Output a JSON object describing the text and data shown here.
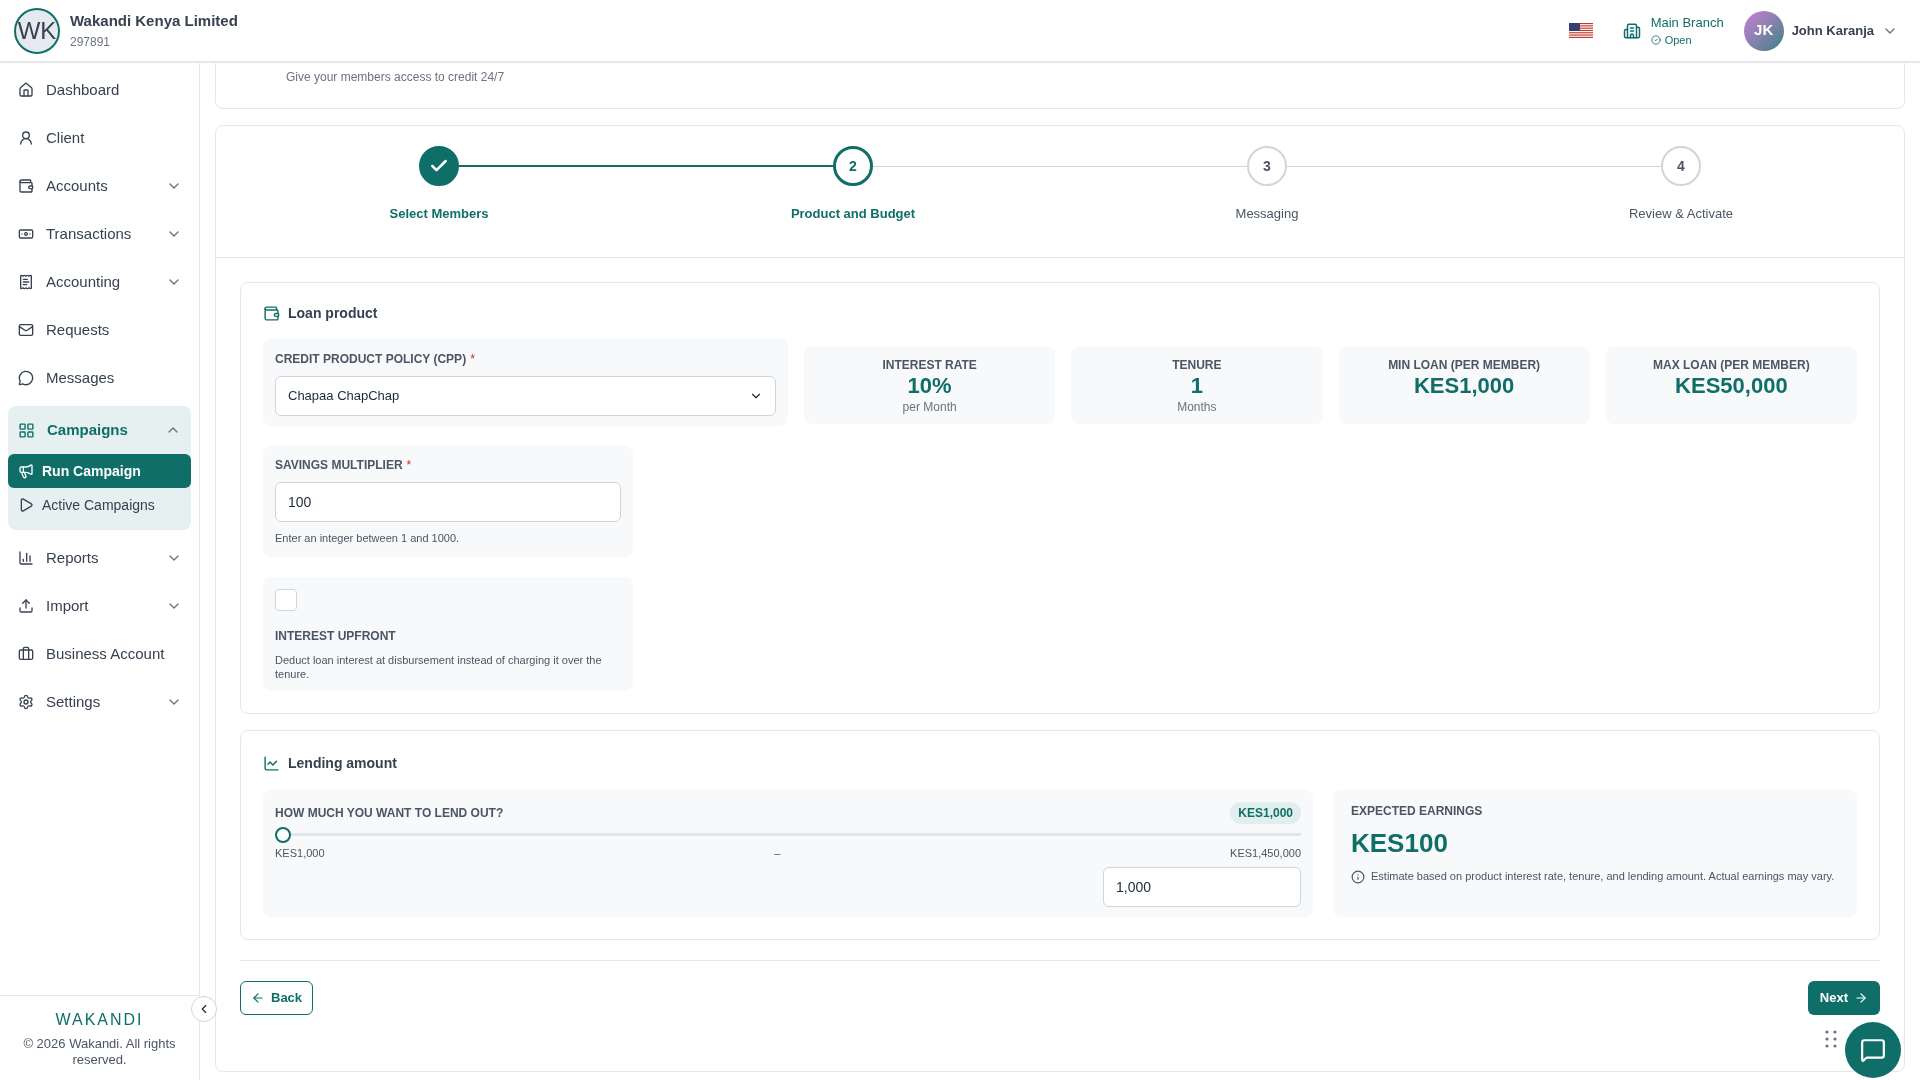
{
  "org": {
    "initials": "WK",
    "name": "Wakandi Kenya Limited",
    "code": "297891"
  },
  "header": {
    "branch": {
      "name": "Main Branch",
      "status": "Open"
    },
    "user": {
      "initials": "JK",
      "name": "John Karanja"
    }
  },
  "sidebar": {
    "items": [
      {
        "label": "Dashboard",
        "kind": "link"
      },
      {
        "label": "Client",
        "kind": "link"
      },
      {
        "label": "Accounts",
        "kind": "group",
        "expanded": false
      },
      {
        "label": "Transactions",
        "kind": "group",
        "expanded": false
      },
      {
        "label": "Accounting",
        "kind": "group",
        "expanded": false
      },
      {
        "label": "Requests",
        "kind": "link"
      },
      {
        "label": "Messages",
        "kind": "link"
      },
      {
        "label": "Campaigns",
        "kind": "group",
        "expanded": true,
        "children": [
          {
            "label": "Run Campaign",
            "selected": true
          },
          {
            "label": "Active Campaigns",
            "selected": false
          }
        ]
      },
      {
        "label": "Reports",
        "kind": "group",
        "expanded": false
      },
      {
        "label": "Import",
        "kind": "group",
        "expanded": false
      },
      {
        "label": "Business Account",
        "kind": "link"
      },
      {
        "label": "Settings",
        "kind": "group",
        "expanded": false
      }
    ],
    "logo": "WAKANDI",
    "copyright": "© 2026 Wakandi. All rights reserved."
  },
  "banner": {
    "subtitle": "Give your members access to credit 24/7"
  },
  "stepper": {
    "steps": [
      {
        "label": "Select Members",
        "completed": true,
        "selected": false
      },
      {
        "number": "2",
        "label": "Product and Budget",
        "completed": false,
        "selected": true
      },
      {
        "number": "3",
        "label": "Messaging",
        "completed": false,
        "selected": false
      },
      {
        "number": "4",
        "label": "Review & Activate",
        "completed": false,
        "selected": false
      }
    ]
  },
  "loan_product": {
    "title": "Loan product",
    "policy": {
      "label": "CREDIT PRODUCT POLICY (CPP)",
      "required_mark": "*",
      "value": "Chapaa ChapChap"
    },
    "stats": [
      {
        "label": "INTEREST RATE",
        "value": "10%",
        "unit": "per Month"
      },
      {
        "label": "TENURE",
        "value": "1",
        "unit": "Months"
      },
      {
        "label": "MIN LOAN (PER MEMBER)",
        "value": "KES1,000"
      },
      {
        "label": "MAX LOAN (PER MEMBER)",
        "value": "KES50,000"
      }
    ],
    "multiplier": {
      "label": "SAVINGS MULTIPLIER",
      "required_mark": "*",
      "value": "100",
      "hint": "Enter an integer between 1 and 1000."
    },
    "upfront": {
      "label": "INTEREST UPFRONT",
      "checked": false,
      "description": "Deduct loan interest at disbursement instead of charging it over the tenure."
    }
  },
  "lending": {
    "title": "Lending amount",
    "question": "HOW MUCH YOU WANT TO LEND OUT?",
    "badge": "KES1,000",
    "level": 0,
    "min": "KES1,000",
    "separator": "–",
    "max": "KES1,450,000",
    "value": "1,000",
    "earnings": {
      "label": "EXPECTED EARNINGS",
      "value": "KES100",
      "note": "Estimate based on product interest rate, tenure, and lending amount. Actual earnings may vary."
    }
  },
  "actions": {
    "back": "Back",
    "next": "Next"
  }
}
